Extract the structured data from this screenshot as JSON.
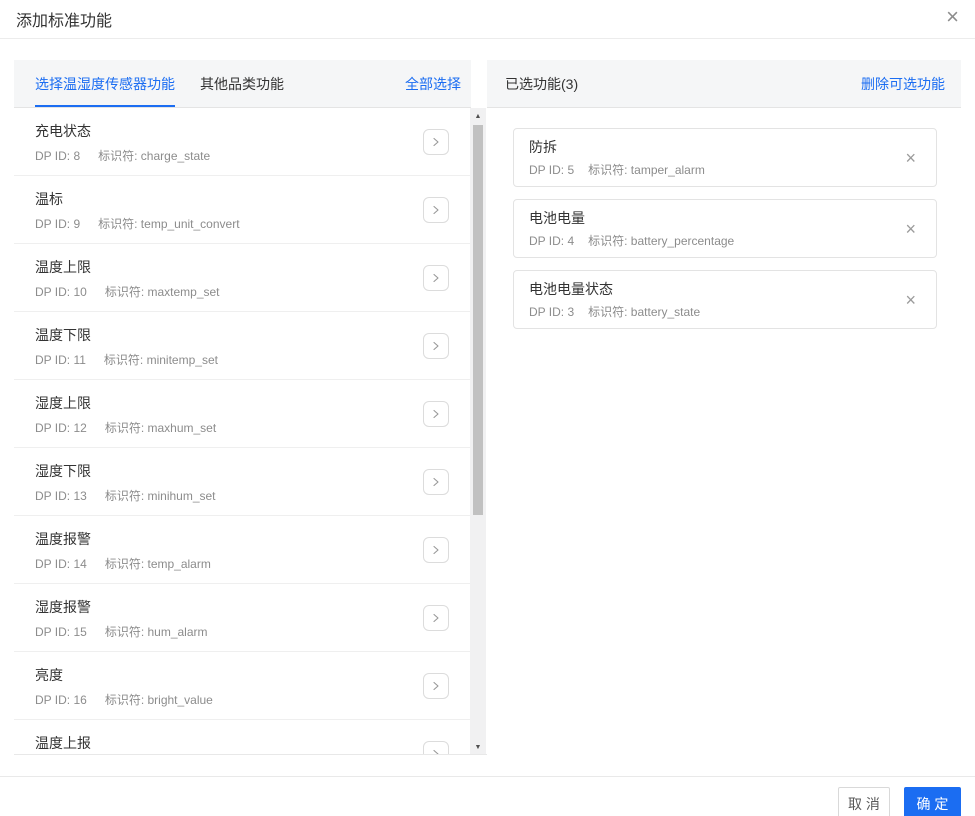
{
  "dialog": {
    "title": "添加标准功能"
  },
  "icons": {
    "close": "×",
    "scroll_up": "▲",
    "scroll_down": "▼"
  },
  "colors": {
    "accent_blue": "#1b6df2",
    "header_bg": "#f5f6f7",
    "border": "#e4e4e4"
  },
  "left_panel": {
    "tabs": [
      {
        "label": "选择温湿度传感器功能",
        "active": true
      },
      {
        "label": "其他品类功能",
        "active": false
      }
    ],
    "select_all_label": "全部选择",
    "items": [
      {
        "name": "充电状态",
        "dp_id": "DP ID: 8",
        "identifier": "标识符: charge_state"
      },
      {
        "name": "温标",
        "dp_id": "DP ID: 9",
        "identifier": "标识符: temp_unit_convert"
      },
      {
        "name": "温度上限",
        "dp_id": "DP ID: 10",
        "identifier": "标识符: maxtemp_set"
      },
      {
        "name": "温度下限",
        "dp_id": "DP ID: 11",
        "identifier": "标识符: minitemp_set"
      },
      {
        "name": "湿度上限",
        "dp_id": "DP ID: 12",
        "identifier": "标识符: maxhum_set"
      },
      {
        "name": "湿度下限",
        "dp_id": "DP ID: 13",
        "identifier": "标识符: minihum_set"
      },
      {
        "name": "温度报警",
        "dp_id": "DP ID: 14",
        "identifier": "标识符: temp_alarm"
      },
      {
        "name": "湿度报警",
        "dp_id": "DP ID: 15",
        "identifier": "标识符: hum_alarm"
      },
      {
        "name": "亮度",
        "dp_id": "DP ID: 16",
        "identifier": "标识符: bright_value"
      },
      {
        "name": "温度上报",
        "dp_id": "",
        "identifier": ""
      }
    ]
  },
  "right_panel": {
    "title": "已选功能(3)",
    "remove_optional_label": "删除可选功能",
    "items": [
      {
        "name": "防拆",
        "dp_id": "DP ID: 5",
        "identifier": "标识符: tamper_alarm"
      },
      {
        "name": "电池电量",
        "dp_id": "DP ID: 4",
        "identifier": "标识符: battery_percentage"
      },
      {
        "name": "电池电量状态",
        "dp_id": "DP ID: 3",
        "identifier": "标识符: battery_state"
      }
    ]
  },
  "footer": {
    "cancel_label": "取 消",
    "confirm_label": "确 定"
  }
}
